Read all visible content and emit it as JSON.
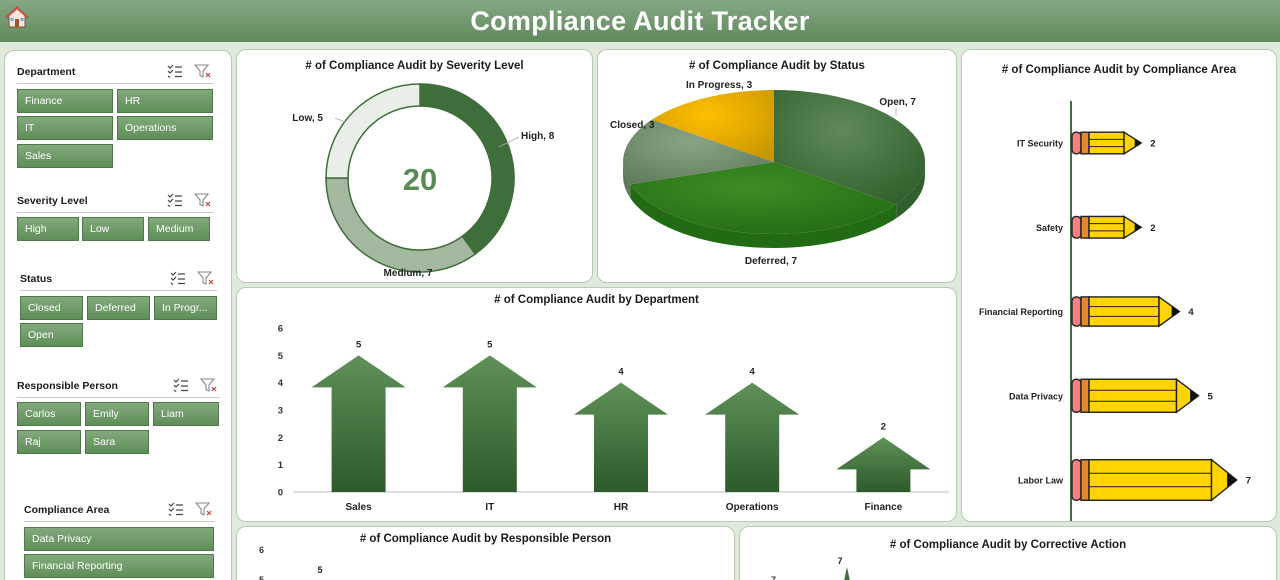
{
  "header": {
    "title": "Compliance Audit Tracker"
  },
  "slicers": [
    {
      "id": "department",
      "title": "Department",
      "items": [
        "Finance",
        "HR",
        "IT",
        "Operations",
        "Sales"
      ]
    },
    {
      "id": "severity",
      "title": "Severity Level",
      "items": [
        "High",
        "Low",
        "Medium"
      ]
    },
    {
      "id": "status",
      "title": "Status",
      "items": [
        "Closed",
        "Deferred",
        "In Progr...",
        "Open"
      ]
    },
    {
      "id": "person",
      "title": "Responsible Person",
      "items": [
        "Carlos",
        "Emily",
        "Liam",
        "Raj",
        "Sara"
      ]
    },
    {
      "id": "area",
      "title": "Compliance Area",
      "items": [
        "Data Privacy",
        "Financial Reporting"
      ]
    }
  ],
  "colors": {
    "header": "#6f976b",
    "green_dark": "#3e6e3a",
    "green_mid": "#a3b89f",
    "green_light": "#e9efe8",
    "pencil_yellow": "#ffd400",
    "pencil_pink": "#f48080",
    "pencil_orange": "#e0892f",
    "pie_open": "#5e8a58",
    "pie_deferred": "#3f8c25",
    "pie_closed": "#8aa486",
    "pie_inprogress": "#ffc000"
  },
  "chart_data": [
    {
      "id": "severity",
      "type": "pie",
      "variant": "donut",
      "title": "# of Compliance Audit by Severity Level",
      "center_label": "20",
      "categories": [
        "High",
        "Medium",
        "Low"
      ],
      "values": [
        8,
        7,
        5
      ],
      "labels": [
        "High, 8",
        "Medium, 7",
        "Low, 5"
      ]
    },
    {
      "id": "status",
      "type": "pie",
      "title": "# of Compliance Audit by Status",
      "categories": [
        "Open",
        "Deferred",
        "Closed",
        "In Progress"
      ],
      "values": [
        7,
        7,
        3,
        3
      ],
      "labels": [
        "Open, 7",
        "Deferred, 7",
        "Closed, 3",
        "In Progress, 3"
      ]
    },
    {
      "id": "department",
      "type": "bar",
      "title": "# of Compliance Audit by Department",
      "categories": [
        "Sales",
        "IT",
        "HR",
        "Operations",
        "Finance"
      ],
      "values": [
        5,
        5,
        4,
        4,
        2
      ],
      "ylim": [
        0,
        6
      ],
      "yticks": [
        0,
        1,
        2,
        3,
        4,
        5,
        6
      ]
    },
    {
      "id": "area",
      "type": "bar",
      "orientation": "horizontal",
      "title": "# of Compliance Audit by Compliance Area",
      "categories": [
        "IT Security",
        "Safety",
        "Financial Reporting",
        "Data Privacy",
        "Labor Law"
      ],
      "values": [
        2,
        2,
        4,
        5,
        7
      ]
    },
    {
      "id": "person",
      "type": "bar",
      "title": "# of Compliance Audit by Responsible Person",
      "visible_yticks": [
        "6",
        "5"
      ],
      "visible_value_labels": [
        "5"
      ]
    },
    {
      "id": "corrective",
      "type": "line",
      "title": "# of Compliance Audit by Corrective Action",
      "visible_yticks": [
        "7"
      ],
      "visible_value_labels": [
        "7"
      ]
    }
  ]
}
